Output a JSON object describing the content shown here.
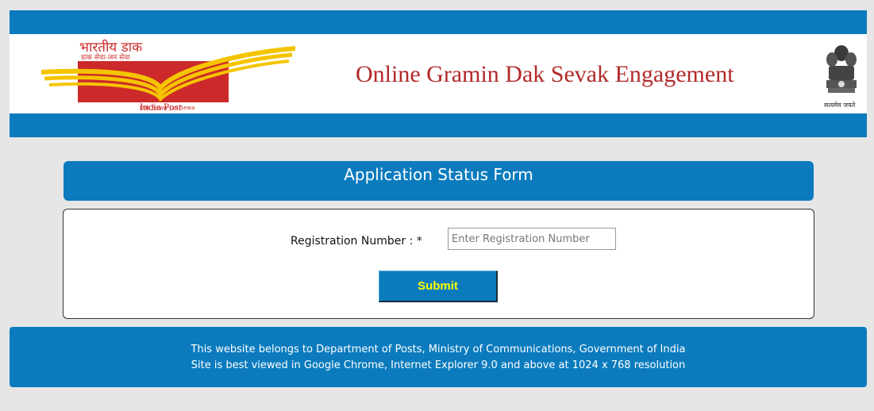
{
  "header": {
    "logo_hindi_text": "भारतीय डाक",
    "logo_hindi_tagline": "डाक सेवा-जन सेवा",
    "logo_name": "India Post",
    "logo_tagline": "Dak Sewa-Jan Sewa",
    "title": "Online Gramin Dak Sevak Engagement",
    "emblem_caption": "सत्यमेव जयते",
    "colors": {
      "bar": "#0b7bbd",
      "title": "#b22a2a",
      "logo_red": "#cc2a2a",
      "logo_yellow": "#f5c400"
    }
  },
  "form": {
    "title": "Application Status Form",
    "registration_label": "Registration Number : *",
    "registration_placeholder": "Enter Registration Number",
    "registration_value": "",
    "submit_label": "Submit",
    "submit_text_color": "#ffff00"
  },
  "footer": {
    "line1": "This website belongs to Department of Posts, Ministry of Communications, Government of India",
    "line2": "Site is best viewed in Google Chrome, Internet Explorer 9.0 and above at 1024 x 768 resolution"
  }
}
